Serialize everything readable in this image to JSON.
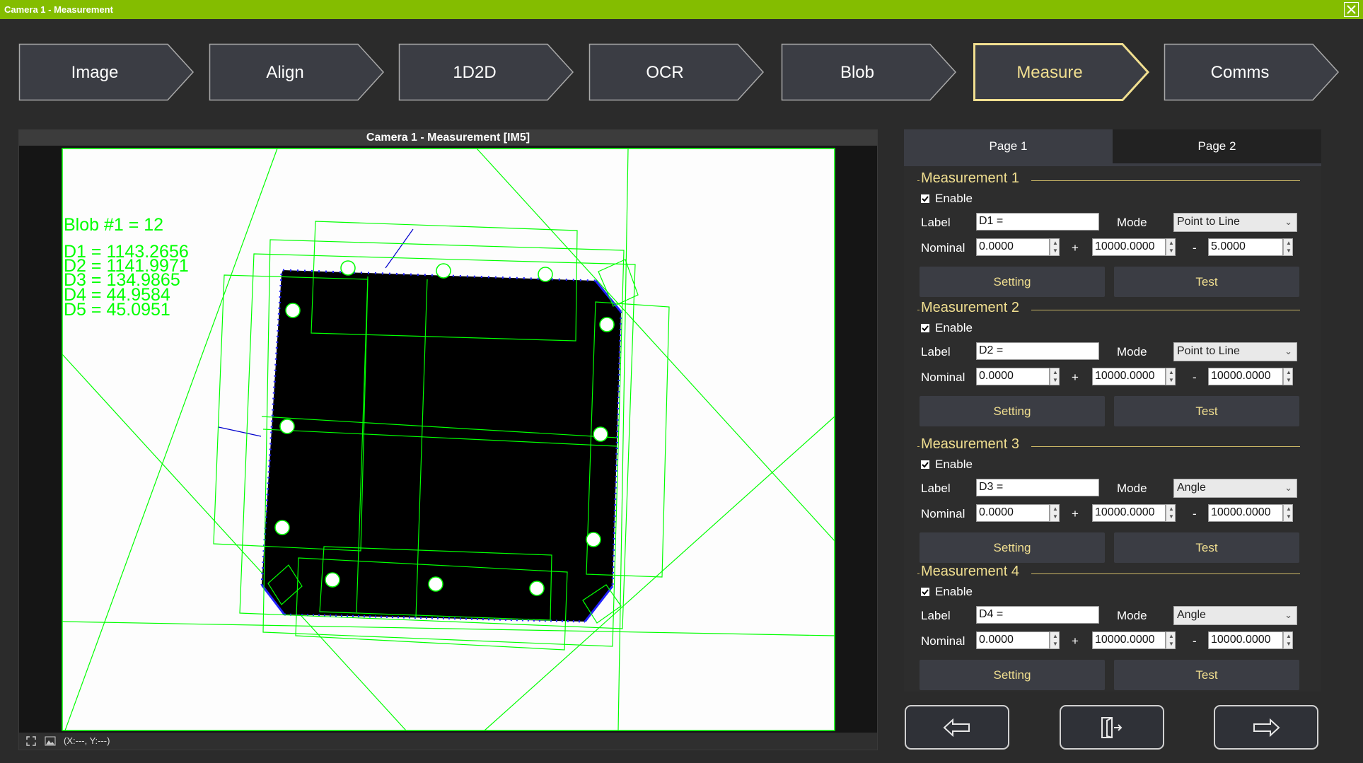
{
  "window": {
    "title": "Camera 1 - Measurement"
  },
  "steps": [
    "Image",
    "Align",
    "1D2D",
    "OCR",
    "Blob",
    "Measure",
    "Comms"
  ],
  "active_step": "Measure",
  "viewer": {
    "title": "Camera 1 -  Measurement  [IM5]",
    "overlay": {
      "blob": "Blob #1 = 12",
      "measurements": [
        "D1 = 1143.2656",
        "D2 = 1141.9971",
        "D3 = 134.9865",
        "D4 = 44.9584",
        "D5 = 45.0951"
      ]
    },
    "coords": "(X:---, Y:---)"
  },
  "tabs": [
    "Page 1",
    "Page 2"
  ],
  "labels": {
    "enable": "Enable",
    "label": "Label",
    "mode": "Mode",
    "nominal": "Nominal",
    "plus": "+",
    "minus": "-",
    "setting": "Setting",
    "test": "Test"
  },
  "measurements": [
    {
      "title": "Measurement 1",
      "label_value": "D1 =",
      "mode": "Point to Line",
      "nominal": "0.0000",
      "plus": "10000.0000",
      "minus": "5.0000"
    },
    {
      "title": "Measurement 2",
      "label_value": "D2 =",
      "mode": "Point to Line",
      "nominal": "0.0000",
      "plus": "10000.0000",
      "minus": "10000.0000"
    },
    {
      "title": "Measurement 3",
      "label_value": "D3 =",
      "mode": "Angle",
      "nominal": "0.0000",
      "plus": "10000.0000",
      "minus": "10000.0000"
    },
    {
      "title": "Measurement 4",
      "label_value": "D4 =",
      "mode": "Angle",
      "nominal": "0.0000",
      "plus": "10000.0000",
      "minus": "10000.0000"
    }
  ],
  "colors": {
    "accent": "#84bd00",
    "gold": "#f1df90",
    "overlay": "#00ff00",
    "edge": "#0000ff"
  },
  "icons": [
    "close-icon",
    "zoom-fit-icon",
    "image-icon",
    "arrow-left-icon",
    "exit-icon",
    "arrow-right-icon"
  ]
}
